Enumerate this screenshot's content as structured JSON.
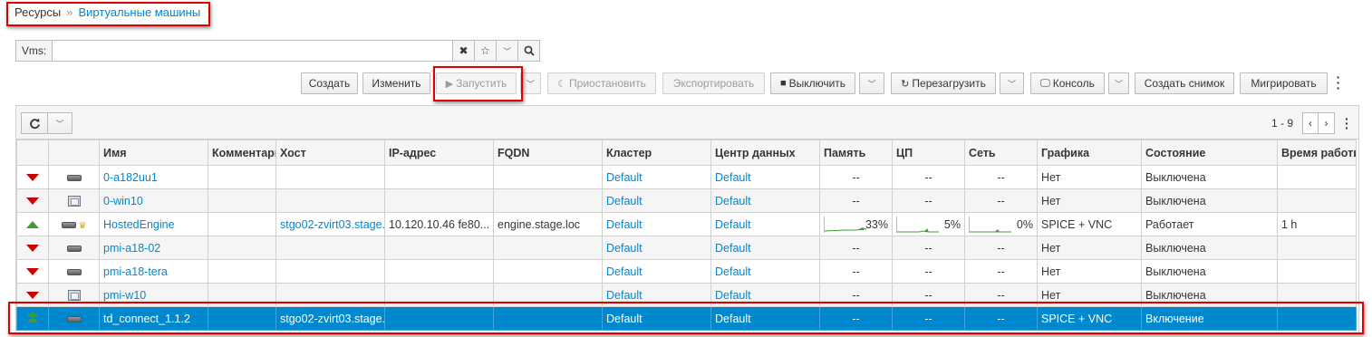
{
  "breadcrumb": {
    "root": "Ресурсы",
    "sep": "»",
    "current": "Виртуальные машины"
  },
  "search": {
    "label": "Vms:",
    "value": "",
    "clear_icon": "close-icon",
    "bookmark_icon": "star-icon",
    "dropdown_icon": "chevron-down-icon",
    "search_icon": "search-icon"
  },
  "toolbar": {
    "create": "Создать",
    "edit": "Изменить",
    "run": "Запустить",
    "suspend": "Приостановить",
    "export": "Экспортировать",
    "shutdown": "Выключить",
    "reboot": "Перезагрузить",
    "console": "Консоль",
    "snapshot": "Создать снимок",
    "migrate": "Мигрировать"
  },
  "pager": {
    "range": "1 - 9"
  },
  "columns": [
    "",
    "",
    "Имя",
    "Комментарий",
    "Хост",
    "IP-адрес",
    "FQDN",
    "Кластер",
    "Центр данных",
    "Память",
    "ЦП",
    "Сеть",
    "Графика",
    "Состояние",
    "Время работы"
  ],
  "rows": [
    {
      "status": "down",
      "type": "server",
      "name": "0-a182uu1",
      "comment": "",
      "host": "",
      "ip": "",
      "fqdn": "",
      "cluster": "Default",
      "dc": "Default",
      "mem": "--",
      "cpu": "--",
      "net": "--",
      "graphics": "Нет",
      "state": "Выключена",
      "uptime": ""
    },
    {
      "status": "down",
      "type": "desktop",
      "name": "0-win10",
      "comment": "",
      "host": "",
      "ip": "",
      "fqdn": "",
      "cluster": "Default",
      "dc": "Default",
      "mem": "--",
      "cpu": "--",
      "net": "--",
      "graphics": "Нет",
      "state": "Выключена",
      "uptime": ""
    },
    {
      "status": "up",
      "type": "server",
      "name": "HostedEngine",
      "comment": "",
      "host": "stgo02-zvirt03.stage.",
      "ip": "10.120.10.46 fe80...",
      "fqdn": "engine.stage.loc",
      "cluster": "Default",
      "dc": "Default",
      "mem": "33%",
      "cpu": "5%",
      "net": "0%",
      "graphics": "SPICE + VNC",
      "state": "Работает",
      "uptime": "1 h"
    },
    {
      "status": "down",
      "type": "server",
      "name": "pmi-a18-02",
      "comment": "",
      "host": "",
      "ip": "",
      "fqdn": "",
      "cluster": "Default",
      "dc": "Default",
      "mem": "--",
      "cpu": "--",
      "net": "--",
      "graphics": "Нет",
      "state": "Выключена",
      "uptime": ""
    },
    {
      "status": "down",
      "type": "server",
      "name": "pmi-a18-tera",
      "comment": "",
      "host": "",
      "ip": "",
      "fqdn": "",
      "cluster": "Default",
      "dc": "Default",
      "mem": "--",
      "cpu": "--",
      "net": "--",
      "graphics": "Нет",
      "state": "Выключена",
      "uptime": ""
    },
    {
      "status": "down",
      "type": "desktop",
      "name": "pmi-w10",
      "comment": "",
      "host": "",
      "ip": "",
      "fqdn": "",
      "cluster": "Default",
      "dc": "Default",
      "mem": "--",
      "cpu": "--",
      "net": "--",
      "graphics": "Нет",
      "state": "Выключена",
      "uptime": ""
    },
    {
      "status": "powering-up",
      "type": "server",
      "name": "td_connect_1.1.2",
      "comment": "",
      "host": "stgo02-zvirt03.stage.",
      "ip": "",
      "fqdn": "",
      "cluster": "Default",
      "dc": "Default",
      "mem": "--",
      "cpu": "--",
      "net": "--",
      "graphics": "SPICE + VNC",
      "state": "Включение",
      "uptime": ""
    }
  ],
  "colors": {
    "accent": "#0088ce",
    "down": "#cc0000",
    "up": "#3f9c35",
    "highlight": "#e10000"
  }
}
